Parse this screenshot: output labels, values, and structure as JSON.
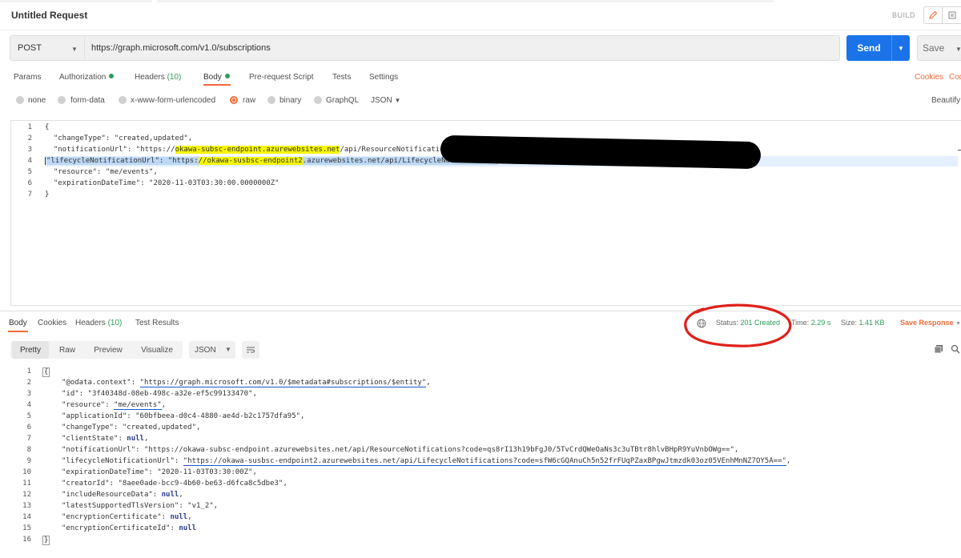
{
  "request": {
    "title": "Untitled Request",
    "build_label": "BUILD",
    "method": "POST",
    "url": "https://graph.microsoft.com/v1.0/subscriptions",
    "send_label": "Send",
    "save_label": "Save"
  },
  "request_tabs": [
    {
      "label": "Params"
    },
    {
      "label": "Authorization"
    },
    {
      "label": "Headers",
      "count": "(10)"
    },
    {
      "label": "Body"
    },
    {
      "label": "Pre-request Script"
    },
    {
      "label": "Tests"
    },
    {
      "label": "Settings"
    }
  ],
  "request_links": {
    "cookies": "Cookies",
    "code": "Code",
    "beautify": "Beautify"
  },
  "body_options": {
    "items": [
      "none",
      "form-data",
      "x-www-form-urlencoded",
      "raw",
      "binary",
      "GraphQL"
    ],
    "selected": "raw",
    "format": "JSON"
  },
  "request_body_lines": [
    {
      "n": "1",
      "text": "{"
    },
    {
      "n": "2",
      "text": "  \"changeType\": \"created,updated\","
    },
    {
      "n": "3",
      "a": "  \"notificationUrl\": \"https://",
      "hl": "okawa-subsc-endpoint.azurewebsites.net",
      "b": "/api/ResourceNotifications"
    },
    {
      "n": "4",
      "a": "\"lifecycleNotificationUrl\": \"https:",
      "hl": "//okawa-susbsc-endpoint2",
      "b": ".azurewebsites.net/api/LifecycleNotifications"
    },
    {
      "n": "5",
      "text": "  \"resource\": \"me/events\","
    },
    {
      "n": "6",
      "text": "  \"expirationDateTime\": \"2020-11-03T03:30:00.0000000Z\""
    },
    {
      "n": "7",
      "text": "}"
    }
  ],
  "response_tabs": [
    {
      "label": "Body"
    },
    {
      "label": "Cookies"
    },
    {
      "label": "Headers",
      "count": "(10)"
    },
    {
      "label": "Test Results"
    }
  ],
  "response_meta": {
    "status_label": "Status:",
    "status_value": "201 Created",
    "time_label": "Time:",
    "time_value": "2.29 s",
    "size_label": "Size:",
    "size_value": "1.41 KB",
    "save_response": "Save Response"
  },
  "view_modes": [
    "Pretty",
    "Raw",
    "Preview",
    "Visualize"
  ],
  "view_format": "JSON",
  "response_lines": [
    {
      "n": "1",
      "text": "{"
    },
    {
      "n": "2",
      "k": "\"@odata.context\"",
      "v": "\"https://graph.microsoft.com/v1.0/$metadata#subscriptions/$entity\"",
      "t": ","
    },
    {
      "n": "3",
      "k": "\"id\"",
      "v": "\"3f40348d-08eb-498c-a32e-ef5c99133470\"",
      "t": ","
    },
    {
      "n": "4",
      "k": "\"resource\"",
      "v": "\"me/events\"",
      "t": ","
    },
    {
      "n": "5",
      "k": "\"applicationId\"",
      "v": "\"60bfbeea-d0c4-4880-ae4d-b2c1757dfa95\"",
      "t": ","
    },
    {
      "n": "6",
      "k": "\"changeType\"",
      "v": "\"created,updated\"",
      "t": ","
    },
    {
      "n": "7",
      "k": "\"clientState\"",
      "v": "null",
      "t": ","
    },
    {
      "n": "8",
      "k": "\"notificationUrl\"",
      "v": "\"https://okawa-subsc-endpoint.azurewebsites.net/api/ResourceNotifications?code=qs8rI13h19bFgJ0/5TvCrdQWeOaNs3c3uTBtr8hlvBHpR9YuVnbOWg==\"",
      "t": ","
    },
    {
      "n": "9",
      "k": "\"lifecycleNotificationUrl\"",
      "v": "\"https://okawa-susbsc-endpoint2.azurewebsites.net/api/LifecycleNotifications?code=sfW6cGQAnuCh5n52frFUqPZaxBPgwJtmzdk03oz05VEnhMnNZ7OY5A==\"",
      "t": ","
    },
    {
      "n": "10",
      "k": "\"expirationDateTime\"",
      "v": "\"2020-11-03T03:30:00Z\"",
      "t": ","
    },
    {
      "n": "11",
      "k": "\"creatorId\"",
      "v": "\"8aee0ade-bcc9-4b60-be63-d6fca8c5dbe3\"",
      "t": ","
    },
    {
      "n": "12",
      "k": "\"includeResourceData\"",
      "v": "null",
      "t": ","
    },
    {
      "n": "13",
      "k": "\"latestSupportedTlsVersion\"",
      "v": "\"v1_2\"",
      "t": ","
    },
    {
      "n": "14",
      "k": "\"encryptionCertificate\"",
      "v": "null",
      "t": ","
    },
    {
      "n": "15",
      "k": "\"encryptionCertificateId\"",
      "v": "null",
      "t": ""
    },
    {
      "n": "16",
      "text": "}"
    }
  ],
  "colors": {
    "accent": "#f26b3a",
    "send": "#1a73e8",
    "status_ok": "#2e9d5a",
    "annotation": "#e0201a"
  }
}
